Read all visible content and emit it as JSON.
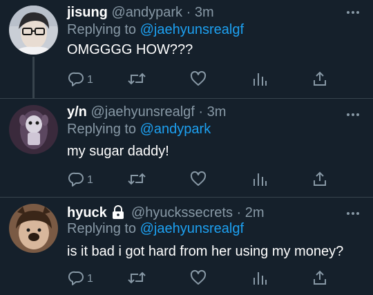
{
  "colors": {
    "background": "#15202b",
    "text_primary": "#ffffff",
    "text_secondary": "#8899a6",
    "link": "#1da1f2",
    "divider": "#38444d"
  },
  "tweets": [
    {
      "name": "jisung",
      "handle": "@andypark",
      "separator": "·",
      "time": "3m",
      "replying_prefix": "Replying to",
      "replying_to": "@jaehyunsrealgf",
      "text": "OMGGGG HOW???",
      "reply_count": "1",
      "locked": false,
      "avatar_icon": "avatar-photo"
    },
    {
      "name": "y/n",
      "handle": "@jaehyunsrealgf",
      "separator": "·",
      "time": "3m",
      "replying_prefix": "Replying to",
      "replying_to": "@andypark",
      "text": "my sugar daddy!",
      "reply_count": "1",
      "locked": false,
      "avatar_icon": "avatar-photo"
    },
    {
      "name": "hyuck",
      "handle": "@hyuckssecrets",
      "separator": "·",
      "time": "2m",
      "replying_prefix": "Replying to",
      "replying_to": "@jaehyunsrealgf",
      "text": "is it bad i got hard from her using my money?",
      "reply_count": "1",
      "locked": true,
      "avatar_icon": "avatar-photo"
    }
  ],
  "icons": {
    "reply": "reply-icon",
    "retweet": "retweet-icon",
    "like": "like-icon",
    "analytics": "analytics-icon",
    "share": "share-icon",
    "more": "more-icon",
    "lock": "lock-icon"
  }
}
